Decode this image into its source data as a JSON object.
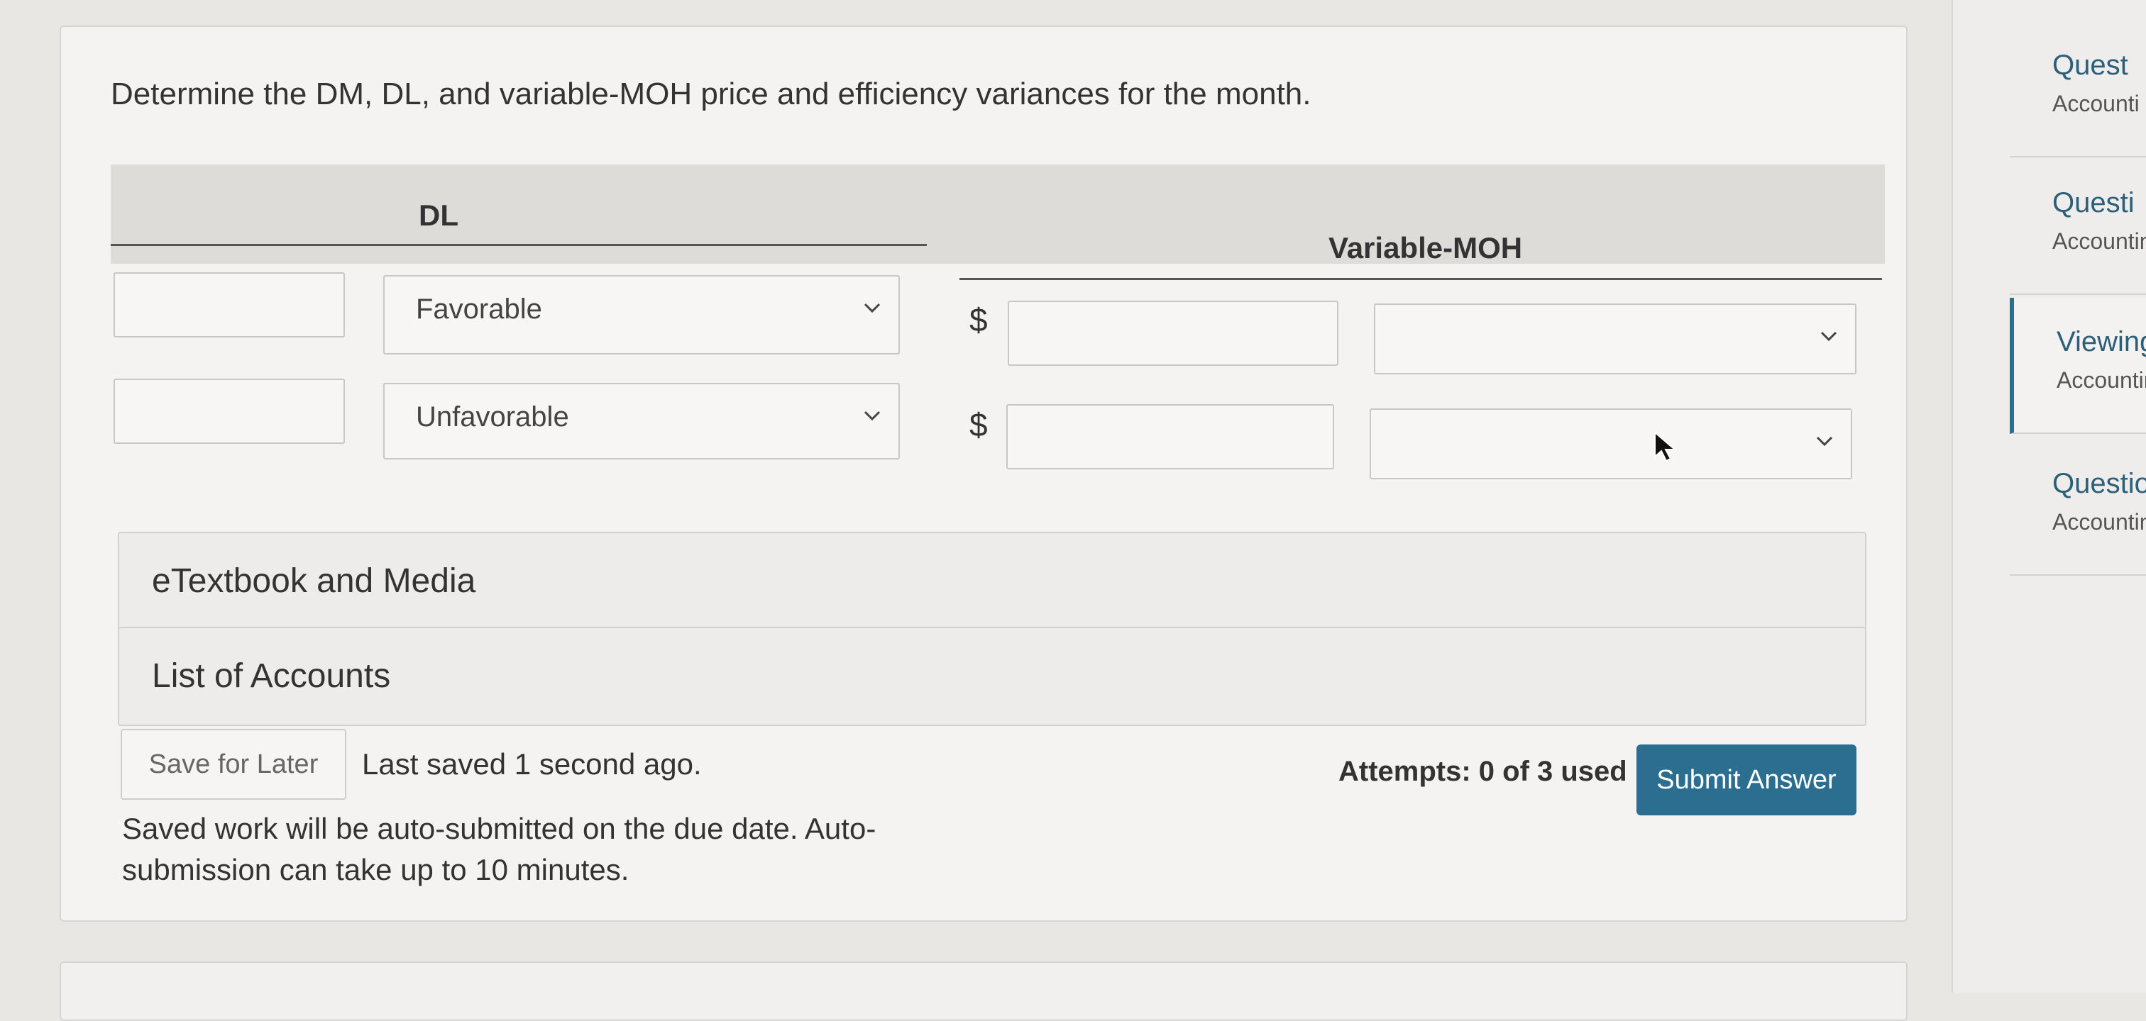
{
  "question": {
    "prompt": "Determine the DM, DL, and variable-MOH price and efficiency variances for the month."
  },
  "table": {
    "header_dl": "DL",
    "header_moh": "Variable-MOH",
    "rows": [
      {
        "dl_select": "Favorable",
        "currency": "$",
        "moh_amount": "",
        "moh_select": ""
      },
      {
        "dl_select": "Unfavorable",
        "currency": "$",
        "moh_amount": "",
        "moh_select": ""
      }
    ]
  },
  "panels": {
    "etextbook": "eTextbook and Media",
    "accounts": "List of Accounts"
  },
  "footer": {
    "save_label": "Save for Later",
    "last_saved": "Last saved 1 second ago.",
    "attempts": "Attempts: 0 of 3 used",
    "submit_label": "Submit Answer",
    "note": "Saved work will be auto-submitted on the due date. Auto-submission can take up to 10 minutes."
  },
  "sidebar": {
    "items": [
      {
        "title": "Quest",
        "subtitle": "Accounti"
      },
      {
        "title": "Questi",
        "subtitle": "Accountin"
      },
      {
        "title": "Viewing",
        "subtitle": "Accounting"
      },
      {
        "title": "Question",
        "subtitle": "Accounting"
      }
    ]
  },
  "colors": {
    "accent": "#2c6e8f",
    "background": "#e9e7e3",
    "card": "#f4f3f1"
  }
}
